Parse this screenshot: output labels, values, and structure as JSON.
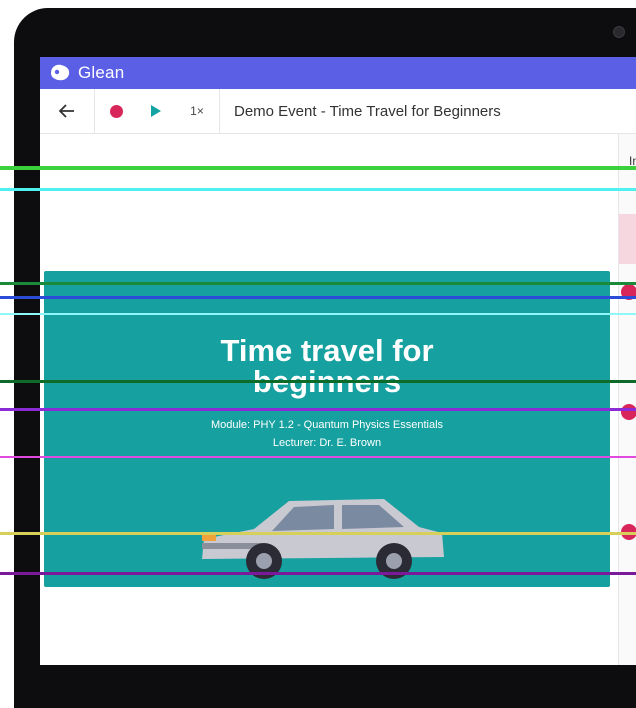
{
  "app": {
    "brand": "Glean"
  },
  "toolbar": {
    "speed": "1×",
    "event_title": "Demo Event - Time Travel for Beginners"
  },
  "side": {
    "label": "In"
  },
  "slide": {
    "title_line1": "Time travel for",
    "title_line2": "beginners",
    "module": "Module: PHY 1.2 - Quantum Physics Essentials",
    "lecturer": "Lecturer: Dr. E. Brown"
  },
  "colors": {
    "brand_bar": "#5b5fe6",
    "record": "#d9265a",
    "play": "#14a3a3",
    "slide_bg": "#16a09f"
  },
  "icons": [
    "back-arrow-icon",
    "record-icon",
    "play-icon",
    "glean-logo-icon",
    "car-illustration"
  ]
}
